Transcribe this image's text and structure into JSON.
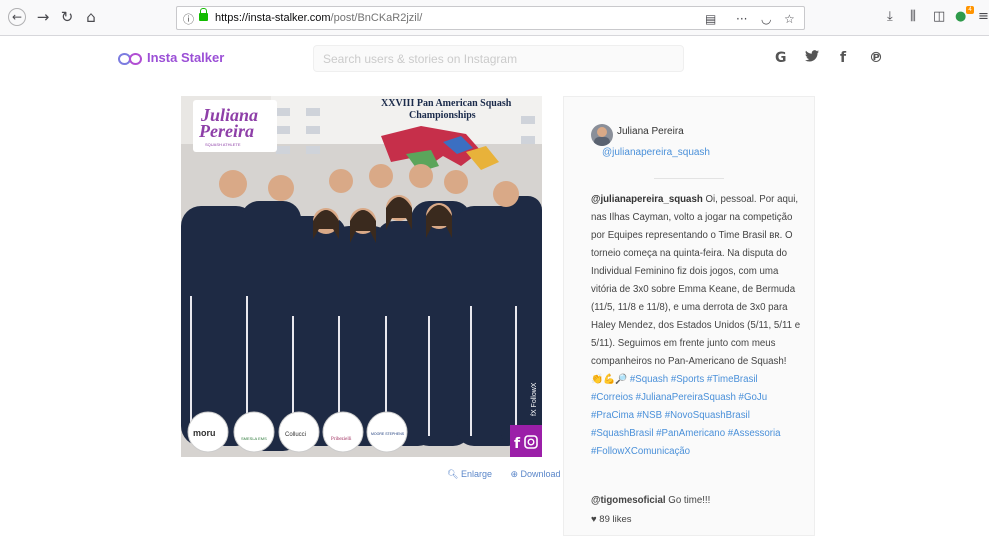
{
  "browser": {
    "url_host": "https://insta-stalker.com",
    "url_path": "/post/BnCKaR2jzil/",
    "badge": "4"
  },
  "site": {
    "brand": "Insta Stalker",
    "search_placeholder": "Search users & stories on Instagram",
    "social": [
      "G",
      "twitter",
      "f",
      "pinterest"
    ]
  },
  "photo": {
    "overlay_name": "Juliana Pereira",
    "overlay_sub": "SQUASH ATHLETE",
    "banner": "XXVIII Pan American Squash Championships",
    "watermark": "FollowX",
    "sponsors": [
      "moru",
      "SMESLA EMS",
      "Collucci",
      "Pribezielli",
      "MOORE STEPHENS"
    ]
  },
  "actions": {
    "enlarge": "Enlarge",
    "download": "Download"
  },
  "post": {
    "username": "Juliana Pereira",
    "handle": "@julianapereira_squash",
    "caption_user": "@julianapereira_squash",
    "caption_text": "Oi, pessoal. Por aqui, nas Ilhas Cayman, volto a jogar na competição por Equipes representando o Time Brasil ʙʀ. O torneio começa na quinta-feira. Na disputa do Individual Feminino fiz dois jogos, com uma vitória de 3x0 sobre Emma Keane, de Bermuda (11/5, 11/8 e 11/8), e uma derrota de 3x0 para Haley Mendez, dos Estados Unidos (5/11, 5/11 e 5/11). Seguimos em frente junto com meus companheiros no Pan-Americano de Squash! 👏💪🔎",
    "hashtags": "#Squash #Sports #TimeBrasil #Correios #JulianaPereiraSquash #GoJu #PraCima #NSB #NovoSquashBrasil #SquashBrasil #PanAmericano #Assessoria #FollowXComunicação",
    "comment_user": "@tigomesoficial",
    "comment_text": "Go time!!!",
    "likes": "89 likes"
  }
}
